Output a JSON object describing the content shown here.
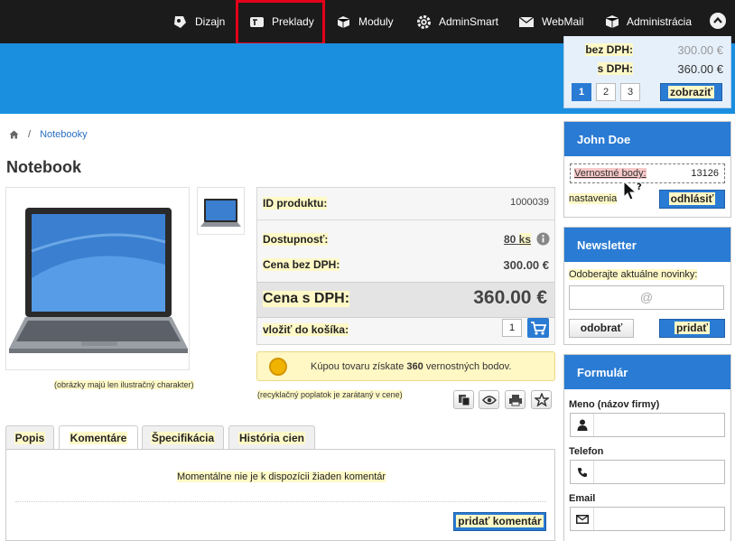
{
  "adminbar": {
    "items": [
      {
        "label": "Dizajn",
        "icon": "palette-icon"
      },
      {
        "label": "Preklady",
        "icon": "translate-icon"
      },
      {
        "label": "Moduly",
        "icon": "cubes-icon"
      },
      {
        "label": "AdminSmart",
        "icon": "gear-icon"
      },
      {
        "label": "WebMail",
        "icon": "envelope-icon"
      },
      {
        "label": "Administrácia",
        "icon": "cube-icon"
      }
    ],
    "highlight_color": "#e2001a"
  },
  "cart": {
    "rows": [
      {
        "label": "bez DPH:",
        "value": "300.00 €"
      },
      {
        "label": "s DPH:",
        "value": "360.00 €"
      }
    ],
    "pages": [
      "1",
      "2",
      "3"
    ],
    "show_button": "zobraziť"
  },
  "breadcrumb": {
    "current": "Notebooky"
  },
  "product": {
    "title": "Notebook",
    "image_note": "(obrázky majú len ilustračný charakter)",
    "id_label": "ID produktu:",
    "id_value": "1000039",
    "availability_label": "Dostupnosť:",
    "availability_value": "80",
    "availability_unit": "ks",
    "price_no_vat_label": "Cena bez DPH:",
    "price_no_vat": "300.00 €",
    "price_vat_label": "Cena s DPH:",
    "price_vat": "360.00 €",
    "add_to_cart_label": "vložiť do košíka:",
    "quantity": "1",
    "points_pre": "Kúpou tovaru získate ",
    "points_value": "360",
    "points_post": " vernostných bodov.",
    "recycle_note": "(recyklačný poplatok je zarátaný v cene)"
  },
  "tabs": [
    {
      "label": "Popis"
    },
    {
      "label": "Komentáre"
    },
    {
      "label": "Špecifikácia"
    },
    {
      "label": "História cien"
    }
  ],
  "comments": {
    "empty_text": "Momentálne nie je k dispozícii žiaden komentár",
    "add_button": "pridať komentár"
  },
  "user_box": {
    "name": "John Doe",
    "points_label": "Vernostné body:",
    "points_value": "13126",
    "settings_link": "nastavenia",
    "logout_button": "odhlásiť"
  },
  "newsletter": {
    "title": "Newsletter",
    "text": "Odoberajte aktuálne novinky:",
    "email_placeholder": "@",
    "unsubscribe_button": "odobrať",
    "subscribe_button": "pridať"
  },
  "form": {
    "title": "Formulár",
    "name_label": "Meno (názov firmy)",
    "phone_label": "Telefon",
    "email_label": "Email"
  },
  "colors": {
    "accent": "#2a7bd3",
    "header": "#1a8fe0",
    "highlight": "#fff9c7"
  }
}
